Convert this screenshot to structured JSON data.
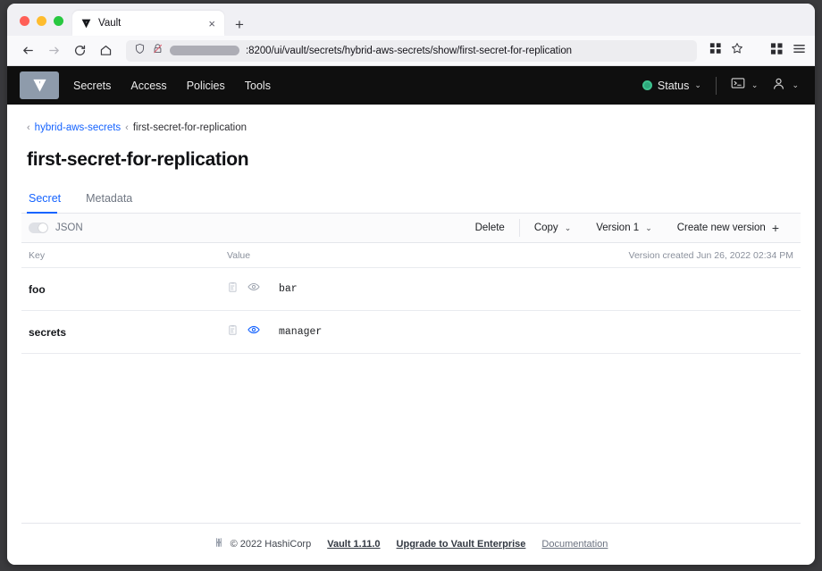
{
  "browser": {
    "tab": {
      "title": "Vault",
      "favicon": "vault-triangle-icon",
      "close": "×"
    },
    "new_tab": "+",
    "url": {
      "redacted_host": true,
      "text": ":8200/ui/vault/secrets/hybrid-aws-secrets/show/first-secret-for-replication"
    },
    "icons": [
      "shield-icon",
      "lock-crossed-icon",
      "extensions-icon",
      "bookmark-star-icon",
      "grid-icon",
      "menu-icon"
    ],
    "nav": {
      "back": "←",
      "forward": "→",
      "reload": "↻",
      "home": "⌂"
    }
  },
  "vault_nav": {
    "logo": "vault-logo",
    "links": [
      "Secrets",
      "Access",
      "Policies",
      "Tools"
    ],
    "status": {
      "label": "Status",
      "chevron": "⌄",
      "color": "#2ea87c"
    },
    "console": {
      "icon": "console-icon",
      "chevron": "⌄"
    },
    "user": {
      "icon": "user-icon",
      "chevron": "⌄"
    }
  },
  "breadcrumb": {
    "arrow": "‹",
    "parent": "hybrid-aws-secrets",
    "current": "first-secret-for-replication"
  },
  "page": {
    "title": "first-secret-for-replication",
    "tabs": [
      {
        "label": "Secret",
        "active": true
      },
      {
        "label": "Metadata",
        "active": false
      }
    ]
  },
  "toolbar": {
    "json_toggle_label": "JSON",
    "json_toggle_on": false,
    "delete_label": "Delete",
    "copy_label": "Copy",
    "version_label": "Version 1",
    "create_label": "Create new version",
    "chevron": "⌄",
    "plus": "+"
  },
  "table": {
    "headers": {
      "key": "Key",
      "value": "Value",
      "meta": "Version created Jun 26, 2022 02:34 PM"
    },
    "rows": [
      {
        "key": "foo",
        "value": "bar",
        "copy_icon": "copy-icon",
        "eye_icon": "eye-icon",
        "eye_active": false
      },
      {
        "key": "secrets",
        "value": "manager",
        "copy_icon": "copy-icon",
        "eye_icon": "eye-icon",
        "eye_active": true
      }
    ]
  },
  "footer": {
    "logo": "hashicorp-logo",
    "copyright": "© 2022 HashiCorp",
    "version_link": "Vault 1.11.0",
    "upgrade_link": "Upgrade to Vault Enterprise",
    "docs_link": "Documentation"
  }
}
